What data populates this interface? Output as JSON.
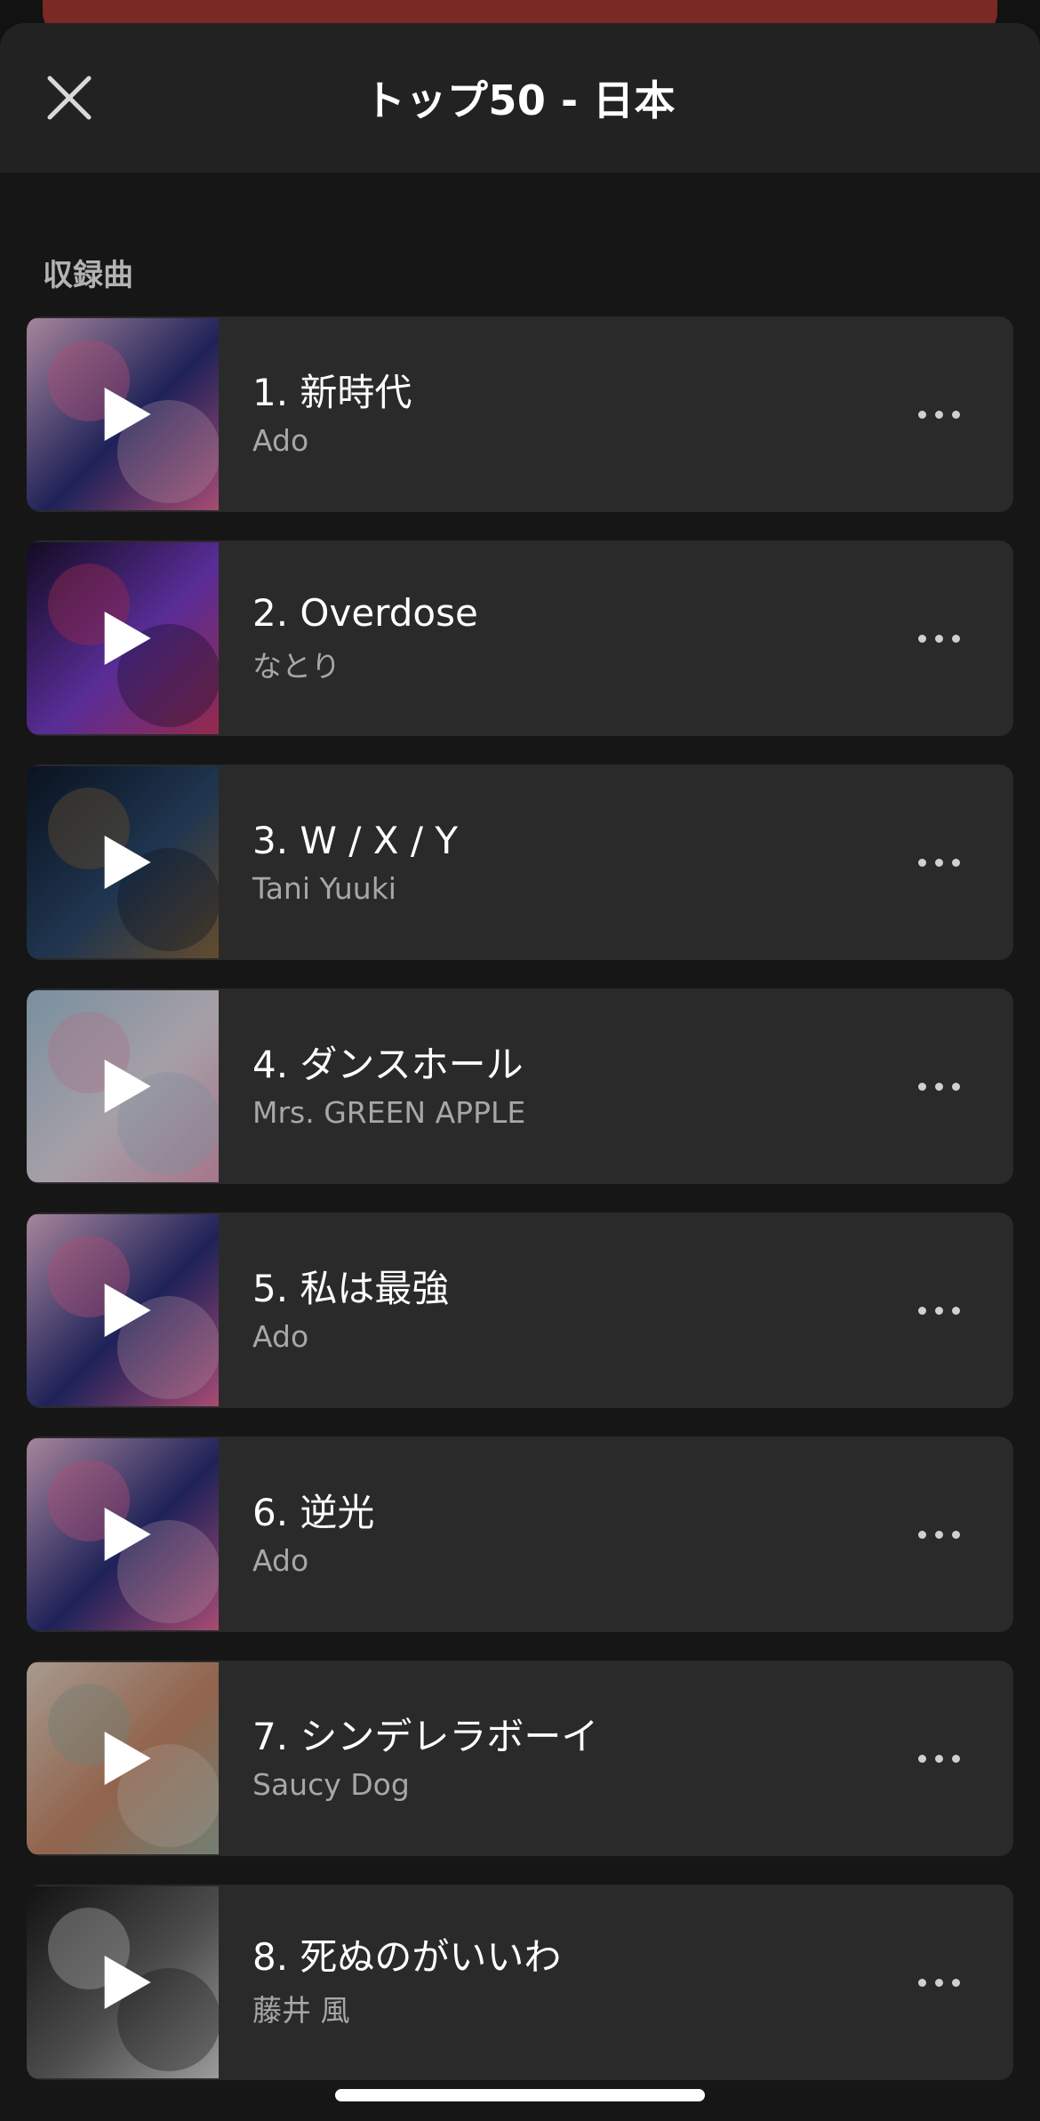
{
  "header": {
    "title": "トップ50 - 日本",
    "close_icon": "close-icon"
  },
  "section": {
    "label": "収録曲"
  },
  "tracks": [
    {
      "title": "1. 新時代",
      "artist": "Ado",
      "cover_icon": "album-cover-anime-red-blue",
      "palette": [
        "#e8b9d8",
        "#2a2f7a",
        "#e86aa0"
      ]
    },
    {
      "title": "2. Overdose",
      "artist": "なとり",
      "cover_icon": "album-cover-purple-robot",
      "palette": [
        "#1a1030",
        "#7b3fd0",
        "#d03a6a"
      ]
    },
    {
      "title": "3. W / X / Y",
      "artist": "Tani Yuuki",
      "cover_icon": "album-cover-dark-deer",
      "palette": [
        "#0e1a2c",
        "#2c4a6e",
        "#8a6a40"
      ]
    },
    {
      "title": "4. ダンスホール",
      "artist": "Mrs. GREEN APPLE",
      "cover_icon": "album-cover-pastel-sky",
      "palette": [
        "#a7c7dc",
        "#e6dde8",
        "#e7a3c0"
      ]
    },
    {
      "title": "5. 私は最強",
      "artist": "Ado",
      "cover_icon": "album-cover-anime-red-blue",
      "palette": [
        "#e8b9d8",
        "#2a2f7a",
        "#e86aa0"
      ]
    },
    {
      "title": "6. 逆光",
      "artist": "Ado",
      "cover_icon": "album-cover-anime-red-blue",
      "palette": [
        "#e8b9d8",
        "#2a2f7a",
        "#e86aa0"
      ]
    },
    {
      "title": "7. シンデレラボーイ",
      "artist": "Saucy Dog",
      "cover_icon": "album-cover-warm-photo",
      "palette": [
        "#e7d6c6",
        "#c98a6a",
        "#9fb0a0"
      ]
    },
    {
      "title": "8. 死ぬのがいいわ",
      "artist": "藤井 風",
      "cover_icon": "album-cover-bw-portrait",
      "palette": [
        "#1a1a1a",
        "#6a6a6a",
        "#d8d8d8"
      ]
    }
  ],
  "icons": {
    "play": "play-icon",
    "more": "more-options-icon"
  },
  "colors": {
    "background": "#121212",
    "row_background": "#2a2a2a",
    "accent_bar": "#7a2a24",
    "secondary_text": "#a7a7a7"
  }
}
